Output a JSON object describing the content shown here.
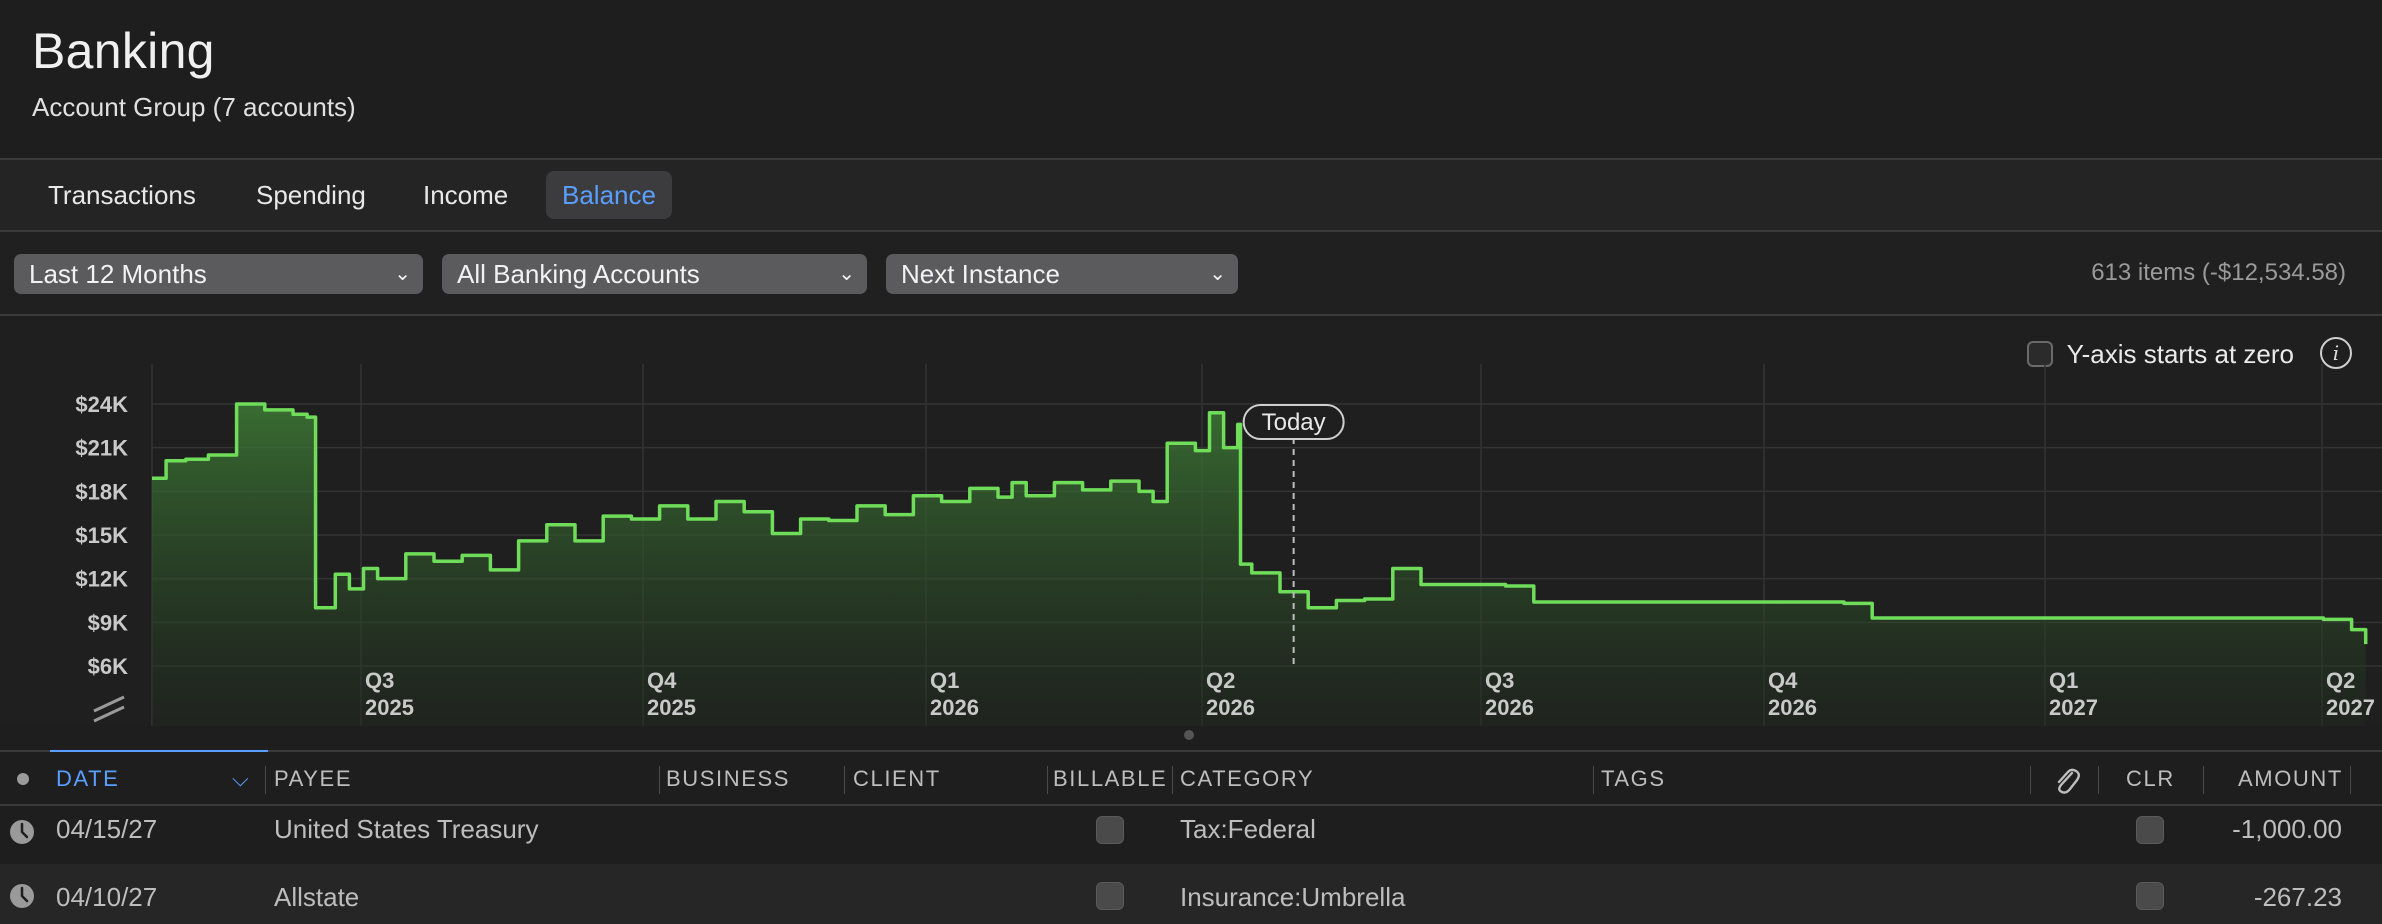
{
  "header": {
    "title": "Banking",
    "subtitle": "Account Group (7 accounts)"
  },
  "tabs": [
    {
      "label": "Transactions",
      "active": false
    },
    {
      "label": "Spending",
      "active": false
    },
    {
      "label": "Income",
      "active": false
    },
    {
      "label": "Balance",
      "active": true
    }
  ],
  "filters": {
    "period": "Last 12 Months",
    "accounts": "All Banking Accounts",
    "scheduled": "Next Instance",
    "items_summary": "613 items (-$12,534.58)"
  },
  "chart_options": {
    "y_axis_zero_label": "Y-axis starts at zero",
    "y_axis_zero_checked": false,
    "today_label": "Today"
  },
  "colors": {
    "accent": "#5a9fff",
    "line": "#6fdc5a",
    "background": "#1e1e1e"
  },
  "chart_data": {
    "type": "area",
    "title": "",
    "xlabel": "",
    "ylabel": "",
    "y_ticks": [
      "$24K",
      "$21K",
      "$18K",
      "$15K",
      "$12K",
      "$9K",
      "$6K"
    ],
    "ylim": [
      6000,
      24000
    ],
    "x_ticks": [
      {
        "label1": "Q3",
        "label2": "2025"
      },
      {
        "label1": "Q4",
        "label2": "2025"
      },
      {
        "label1": "Q1",
        "label2": "2026"
      },
      {
        "label1": "Q2",
        "label2": "2026"
      },
      {
        "label1": "Q3",
        "label2": "2026"
      },
      {
        "label1": "Q4",
        "label2": "2026"
      },
      {
        "label1": "Q1",
        "label2": "2027"
      },
      {
        "label1": "Q2",
        "label2": "2027"
      }
    ],
    "series": [
      {
        "values": [
          [
            0.0,
            18900
          ],
          [
            0.05,
            20100
          ],
          [
            0.12,
            20200
          ],
          [
            0.2,
            20500
          ],
          [
            0.3,
            24000
          ],
          [
            0.4,
            23600
          ],
          [
            0.5,
            23300
          ],
          [
            0.55,
            23100
          ],
          [
            0.58,
            10000
          ],
          [
            0.65,
            12300
          ],
          [
            0.7,
            11300
          ],
          [
            0.75,
            12700
          ],
          [
            0.8,
            12000
          ],
          [
            0.9,
            13700
          ],
          [
            1.0,
            13200
          ],
          [
            1.1,
            13600
          ],
          [
            1.2,
            12600
          ],
          [
            1.3,
            14600
          ],
          [
            1.4,
            15700
          ],
          [
            1.5,
            14600
          ],
          [
            1.6,
            16300
          ],
          [
            1.7,
            16100
          ],
          [
            1.8,
            17000
          ],
          [
            1.9,
            16100
          ],
          [
            2.0,
            17300
          ],
          [
            2.1,
            16600
          ],
          [
            2.2,
            15100
          ],
          [
            2.3,
            16100
          ],
          [
            2.4,
            16000
          ],
          [
            2.5,
            17000
          ],
          [
            2.6,
            16400
          ],
          [
            2.7,
            17700
          ],
          [
            2.8,
            17300
          ],
          [
            2.9,
            18200
          ],
          [
            3.0,
            17600
          ],
          [
            3.05,
            18600
          ],
          [
            3.1,
            17700
          ],
          [
            3.2,
            18600
          ],
          [
            3.3,
            18100
          ],
          [
            3.4,
            18700
          ],
          [
            3.5,
            18000
          ],
          [
            3.55,
            17300
          ],
          [
            3.6,
            21300
          ],
          [
            3.7,
            20800
          ],
          [
            3.75,
            23400
          ],
          [
            3.8,
            21000
          ],
          [
            3.85,
            22600
          ],
          [
            3.86,
            13000
          ],
          [
            3.9,
            12400
          ],
          [
            4.0,
            11100
          ],
          [
            4.1,
            10000
          ],
          [
            4.2,
            10500
          ],
          [
            4.3,
            10600
          ],
          [
            4.4,
            12700
          ],
          [
            4.5,
            11600
          ],
          [
            4.8,
            11500
          ],
          [
            4.9,
            10400
          ],
          [
            6.0,
            10300
          ],
          [
            6.1,
            9300
          ],
          [
            7.7,
            9200
          ],
          [
            7.8,
            8500
          ],
          [
            7.85,
            7500
          ]
        ]
      }
    ],
    "legend": "none",
    "grid": true
  },
  "table": {
    "columns": [
      "DATE",
      "PAYEE",
      "BUSINESS",
      "CLIENT",
      "BILLABLE",
      "CATEGORY",
      "TAGS",
      "CLR",
      "AMOUNT"
    ],
    "rows": [
      {
        "date": "04/15/27",
        "payee": "United States Treasury",
        "category": "Tax:Federal",
        "amount": "-1,000.00"
      },
      {
        "date": "04/10/27",
        "payee": "Allstate",
        "category": "Insurance:Umbrella",
        "amount": "-267.23"
      }
    ]
  }
}
